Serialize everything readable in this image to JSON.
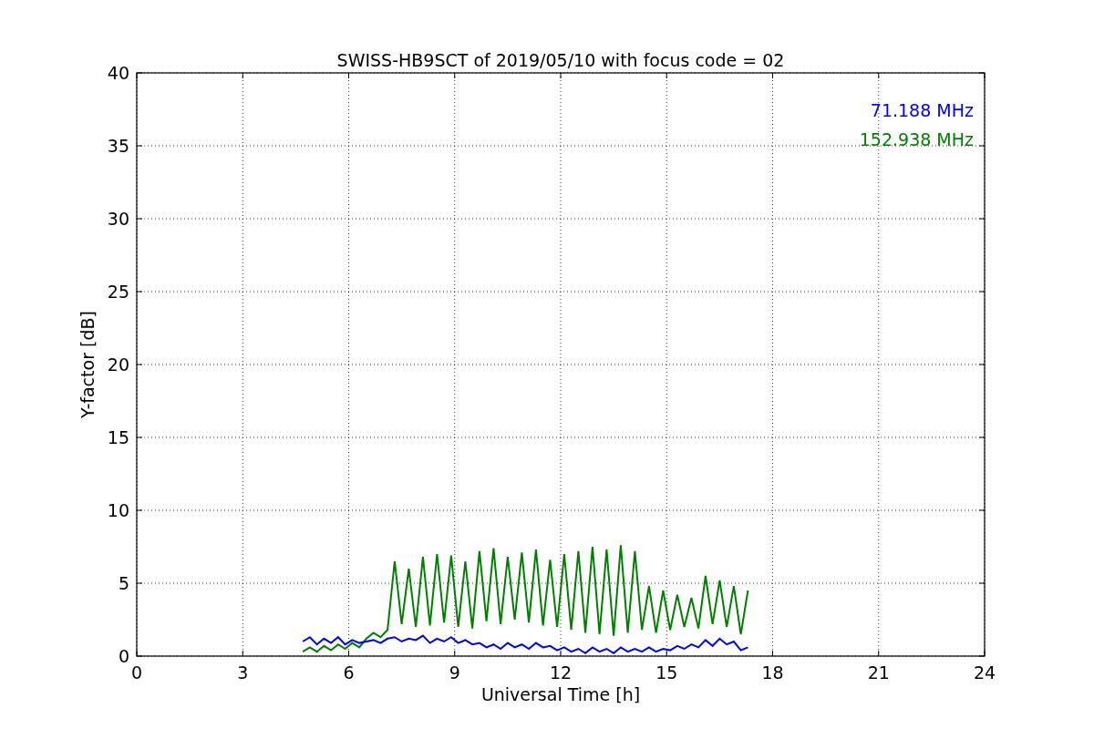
{
  "plot": {
    "chart_data": {
      "type": "line",
      "title": "SWISS-HB9SCT of 2019/05/10 with focus code = 02",
      "xlabel": "Universal Time [h]",
      "ylabel": "Y-factor [dB]",
      "x": [
        4.7,
        4.9,
        5.1,
        5.3,
        5.5,
        5.7,
        5.9,
        6.1,
        6.3,
        6.5,
        6.7,
        6.9,
        7.1,
        7.3,
        7.5,
        7.7,
        7.9,
        8.1,
        8.3,
        8.5,
        8.7,
        8.9,
        9.1,
        9.3,
        9.5,
        9.7,
        9.9,
        10.1,
        10.3,
        10.5,
        10.7,
        10.9,
        11.1,
        11.3,
        11.5,
        11.7,
        11.9,
        12.1,
        12.3,
        12.5,
        12.7,
        12.9,
        13.1,
        13.3,
        13.5,
        13.7,
        13.9,
        14.1,
        14.3,
        14.5,
        14.7,
        14.9,
        15.1,
        15.3,
        15.5,
        15.7,
        15.9,
        16.1,
        16.3,
        16.5,
        16.7,
        16.9,
        17.1,
        17.3
      ],
      "series": [
        {
          "name": "71.188 MHz",
          "color": "#0000ff",
          "values": [
            1.0,
            1.3,
            0.8,
            1.2,
            0.9,
            1.3,
            0.8,
            1.1,
            0.9,
            1.0,
            1.1,
            0.9,
            1.2,
            1.3,
            1.0,
            1.2,
            1.1,
            1.4,
            0.9,
            1.2,
            1.0,
            1.3,
            0.9,
            1.1,
            0.8,
            0.9,
            0.6,
            0.8,
            0.5,
            0.9,
            0.6,
            0.8,
            0.5,
            0.9,
            0.6,
            0.7,
            0.4,
            0.6,
            0.3,
            0.5,
            0.2,
            0.6,
            0.3,
            0.5,
            0.2,
            0.6,
            0.3,
            0.5,
            0.3,
            0.6,
            0.3,
            0.5,
            0.4,
            0.7,
            0.5,
            0.8,
            0.6,
            1.1,
            0.7,
            1.2,
            0.8,
            1.0,
            0.4,
            0.6
          ]
        },
        {
          "name": "152.938 MHz",
          "color": "#008000",
          "values": [
            0.3,
            0.6,
            0.3,
            0.7,
            0.4,
            0.8,
            0.5,
            0.9,
            0.6,
            1.2,
            1.6,
            1.3,
            1.8,
            6.5,
            2.2,
            6.0,
            2.0,
            6.8,
            2.1,
            7.0,
            2.3,
            6.9,
            2.0,
            6.5,
            1.9,
            7.2,
            2.4,
            7.4,
            2.2,
            6.8,
            2.5,
            7.1,
            2.3,
            7.3,
            2.1,
            6.6,
            2.0,
            7.0,
            1.8,
            7.2,
            1.6,
            7.5,
            1.5,
            7.3,
            1.4,
            7.6,
            1.6,
            7.2,
            1.8,
            4.8,
            1.6,
            4.5,
            1.8,
            4.2,
            2.0,
            4.0,
            1.9,
            5.5,
            2.2,
            5.2,
            2.0,
            4.8,
            1.5,
            4.5
          ]
        }
      ],
      "grid": true,
      "xlim": [
        0,
        24
      ],
      "ylim": [
        0,
        40
      ],
      "xticks": [
        0,
        3,
        6,
        9,
        12,
        15,
        18,
        21,
        24
      ],
      "yticks": [
        0,
        5,
        10,
        15,
        20,
        25,
        30,
        35,
        40
      ]
    }
  }
}
